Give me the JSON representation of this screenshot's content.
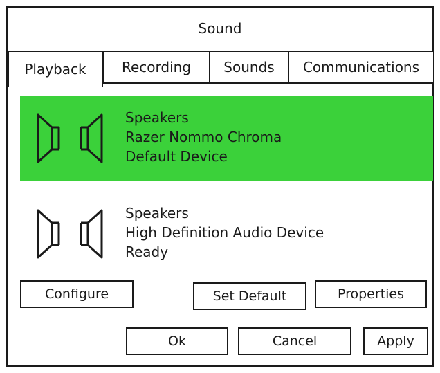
{
  "window": {
    "title": "Sound"
  },
  "tabs": [
    {
      "label": "Playback",
      "active": true
    },
    {
      "label": "Recording",
      "active": false
    },
    {
      "label": "Sounds",
      "active": false
    },
    {
      "label": "Communications",
      "active": false
    }
  ],
  "devices": [
    {
      "type": "Speakers",
      "name": "Razer Nommo Chroma",
      "status": "Default Device",
      "selected": true,
      "icon": "speakers-icon"
    },
    {
      "type": "Speakers",
      "name": "High Definition Audio Device",
      "status": "Ready",
      "selected": false,
      "icon": "speakers-icon"
    }
  ],
  "buttons": {
    "configure": "Configure",
    "set_default": "Set Default",
    "properties": "Properties",
    "ok": "Ok",
    "cancel": "Cancel",
    "apply": "Apply"
  },
  "colors": {
    "selection": "#3bd13a",
    "border": "#1a1a1a"
  }
}
